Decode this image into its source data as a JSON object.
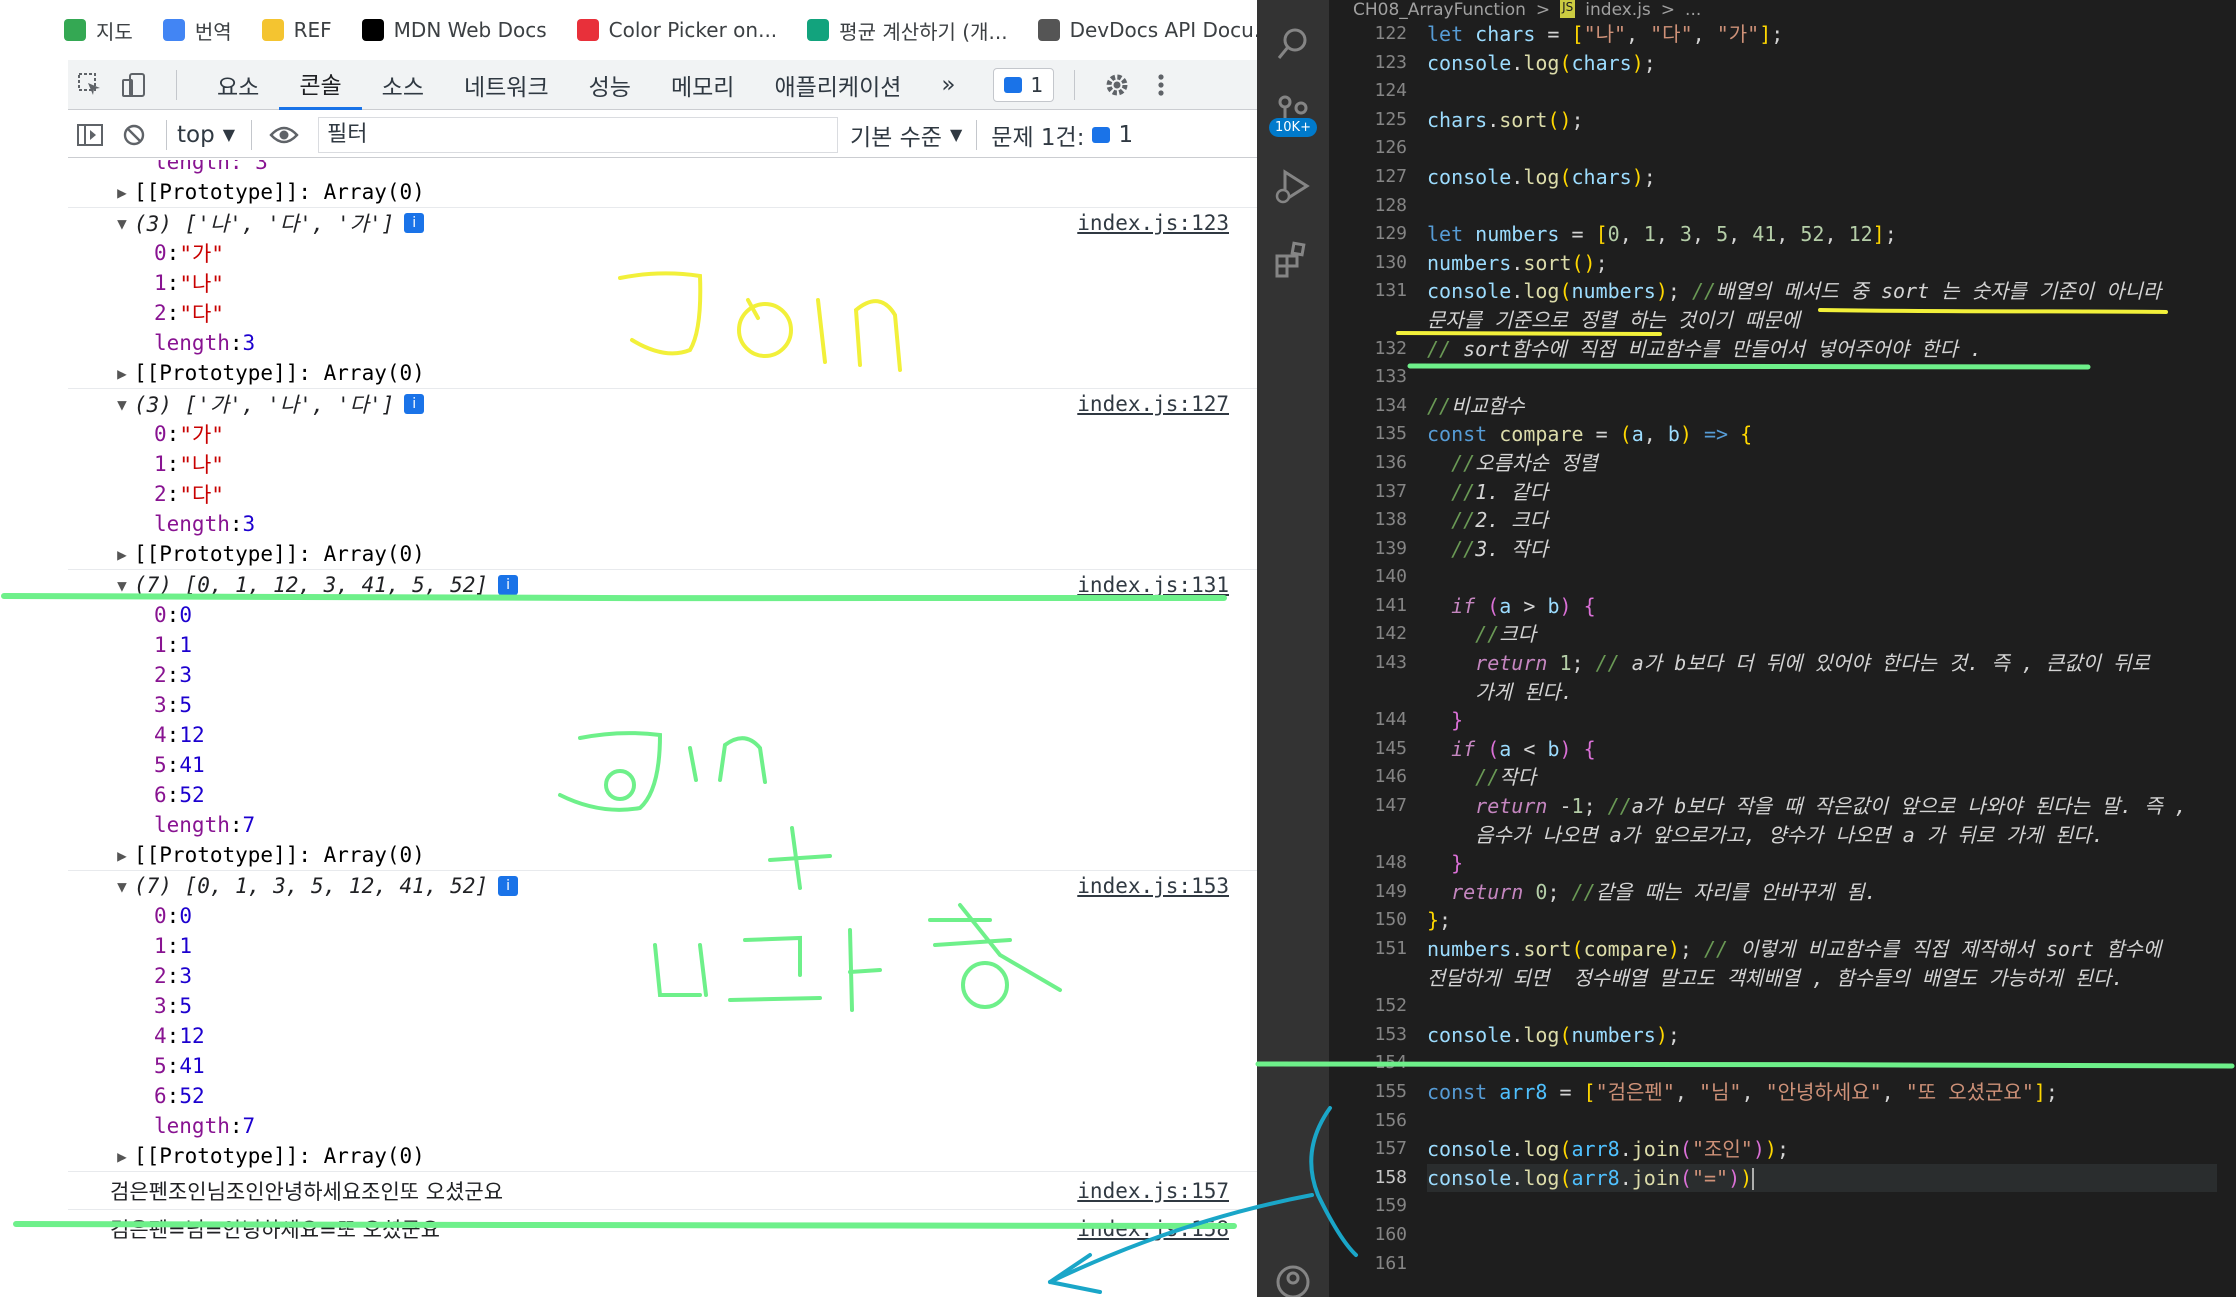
{
  "bookmarks": [
    {
      "label": "지도",
      "icon": "map-pin-icon",
      "color": "#34a853"
    },
    {
      "label": "번역",
      "icon": "translate-icon",
      "color": "#4285f4"
    },
    {
      "label": "REF",
      "icon": "folder-icon",
      "color": "#f4c430"
    },
    {
      "label": "MDN Web Docs",
      "icon": "mdn-icon",
      "color": "#000000"
    },
    {
      "label": "Color Picker on...",
      "icon": "color-picker-icon",
      "color": "#e8303a"
    },
    {
      "label": "평균 계산하기 (개...",
      "icon": "calculator-icon",
      "color": "#12a37d"
    },
    {
      "label": "DevDocs API Docu...",
      "icon": "devdocs-icon",
      "color": "#555555"
    }
  ],
  "devtools": {
    "tabs": [
      "요소",
      "콘솔",
      "소스",
      "네트워크",
      "성능",
      "메모리",
      "애플리케이션"
    ],
    "active_tab": "콘솔",
    "more_tabs": "»",
    "issues_count": "1",
    "context": "top",
    "filter_placeholder": "필터",
    "level": "기본 수준",
    "issues_label": "문제 1건:",
    "issues_label_count": "1"
  },
  "console": {
    "truncated_top": "length: 3",
    "prototype": "[[Prototype]]: Array(0)",
    "length_key": "length",
    "groups": [
      {
        "preview": "(3) ['나', '다', '가']",
        "source": "index.js:123",
        "items": [
          [
            "0",
            "\"가\""
          ],
          [
            "1",
            "\"나\""
          ],
          [
            "2",
            "\"다\""
          ]
        ],
        "length": "3"
      },
      {
        "preview": "(3) ['가', '나', '다']",
        "source": "index.js:127",
        "items": [
          [
            "0",
            "\"가\""
          ],
          [
            "1",
            "\"나\""
          ],
          [
            "2",
            "\"다\""
          ]
        ],
        "length": "3"
      },
      {
        "preview": "(7) [0, 1, 12, 3, 41, 5, 52]",
        "source": "index.js:131",
        "items": [
          [
            "0",
            "0"
          ],
          [
            "1",
            "1"
          ],
          [
            "2",
            "3"
          ],
          [
            "3",
            "5"
          ],
          [
            "4",
            "12"
          ],
          [
            "5",
            "41"
          ],
          [
            "6",
            "52"
          ]
        ],
        "length": "7"
      },
      {
        "preview": "(7) [0, 1, 3, 5, 12, 41, 52]",
        "source": "index.js:153",
        "items": [
          [
            "0",
            "0"
          ],
          [
            "1",
            "1"
          ],
          [
            "2",
            "3"
          ],
          [
            "3",
            "5"
          ],
          [
            "4",
            "12"
          ],
          [
            "5",
            "41"
          ],
          [
            "6",
            "52"
          ]
        ],
        "length": "7"
      }
    ],
    "plain_logs": [
      {
        "text": "검은펜조인님조인안녕하세요조인또 오셨군요",
        "source": "index.js:157"
      },
      {
        "text": "검은펜=님=안녕하세요=또 오셨군요",
        "source": "index.js:158"
      }
    ]
  },
  "vscode": {
    "breadcrumb": [
      "CH08_ArrayFunction",
      ">",
      "JS",
      "index.js",
      ">",
      "..."
    ],
    "badge": "10K+",
    "line_numbers": [
      "122",
      "123",
      "124",
      "125",
      "126",
      "127",
      "128",
      "129",
      "130",
      "131",
      "",
      "132",
      "133",
      "134",
      "135",
      "136",
      "137",
      "138",
      "139",
      "140",
      "141",
      "142",
      "143",
      "",
      "144",
      "145",
      "146",
      "147",
      "",
      "148",
      "149",
      "150",
      "151",
      "",
      "152",
      "153",
      "154",
      "155",
      "156",
      "157",
      "158",
      "159",
      "160",
      "161"
    ],
    "current_line": "158",
    "code_lines": [
      [
        [
          "kw",
          "let "
        ],
        [
          "vr",
          "chars"
        ],
        [
          "",
          ""
        ],
        [
          "",
          " = "
        ],
        [
          "br1",
          "["
        ],
        [
          "s",
          "\"나\""
        ],
        [
          "",
          ", "
        ],
        [
          "s",
          "\"다\""
        ],
        [
          "",
          ", "
        ],
        [
          "s",
          "\"가\""
        ],
        [
          "br1",
          "]"
        ],
        [
          "",
          ";"
        ]
      ],
      [
        [
          "vr",
          "console"
        ],
        [
          "",
          "."
        ],
        [
          "fn",
          "log"
        ],
        [
          "br1",
          "("
        ],
        [
          "vr",
          "chars"
        ],
        [
          "br1",
          ")"
        ],
        [
          "",
          ";"
        ]
      ],
      [],
      [
        [
          "vr",
          "chars"
        ],
        [
          "",
          "."
        ],
        [
          "fn",
          "sort"
        ],
        [
          "br1",
          "()"
        ],
        [
          "",
          ";"
        ]
      ],
      [],
      [
        [
          "vr",
          "console"
        ],
        [
          "",
          "."
        ],
        [
          "fn",
          "log"
        ],
        [
          "br1",
          "("
        ],
        [
          "vr",
          "chars"
        ],
        [
          "br1",
          ")"
        ],
        [
          "",
          ";"
        ]
      ],
      [],
      [
        [
          "kw",
          "let "
        ],
        [
          "vr",
          "numbers"
        ],
        [
          "",
          " = "
        ],
        [
          "br1",
          "["
        ],
        [
          "n",
          "0"
        ],
        [
          "",
          ", "
        ],
        [
          "n",
          "1"
        ],
        [
          "",
          ", "
        ],
        [
          "n",
          "3"
        ],
        [
          "",
          ", "
        ],
        [
          "n",
          "5"
        ],
        [
          "",
          ", "
        ],
        [
          "n",
          "41"
        ],
        [
          "",
          ", "
        ],
        [
          "n",
          "52"
        ],
        [
          "",
          ", "
        ],
        [
          "n",
          "12"
        ],
        [
          "br1",
          "]"
        ],
        [
          "",
          ";"
        ]
      ],
      [
        [
          "vr",
          "numbers"
        ],
        [
          "",
          "."
        ],
        [
          "fn",
          "sort"
        ],
        [
          "br1",
          "()"
        ],
        [
          "",
          ";"
        ]
      ],
      [
        [
          "vr",
          "console"
        ],
        [
          "",
          "."
        ],
        [
          "fn",
          "log"
        ],
        [
          "br1",
          "("
        ],
        [
          "vr",
          "numbers"
        ],
        [
          "br1",
          ")"
        ],
        [
          "",
          "; "
        ],
        [
          "cm",
          "//"
        ],
        [
          "cmw",
          "배열의 메서드 중 sort 는 숫자를 기준이 아니라"
        ]
      ],
      [
        [
          "cmw",
          "문자를 기준으로 정렬 하는 것이기 때문에"
        ]
      ],
      [
        [
          "cm",
          "// "
        ],
        [
          "cmw",
          "sort함수에 직접 비교함수를 만들어서 넣어주어야 한다 ."
        ]
      ],
      [],
      [
        [
          "cm",
          "//"
        ],
        [
          "cmw",
          "비교함수"
        ]
      ],
      [
        [
          "kw",
          "const "
        ],
        [
          "fn",
          "compare"
        ],
        [
          "",
          " = "
        ],
        [
          "br1",
          "("
        ],
        [
          "vr",
          "a"
        ],
        [
          "",
          ", "
        ],
        [
          "vr",
          "b"
        ],
        [
          "br1",
          ")"
        ],
        [
          "",
          " "
        ],
        [
          "kw",
          "=>"
        ],
        [
          "",
          " "
        ],
        [
          "br1",
          "{"
        ]
      ],
      [
        [
          "",
          "  "
        ],
        [
          "cm",
          "//"
        ],
        [
          "cmw",
          "오름차순 정렬"
        ]
      ],
      [
        [
          "",
          "  "
        ],
        [
          "cm",
          "//"
        ],
        [
          "cmw",
          "1. 같다"
        ]
      ],
      [
        [
          "",
          "  "
        ],
        [
          "cm",
          "//"
        ],
        [
          "cmw",
          "2. 크다"
        ]
      ],
      [
        [
          "",
          "  "
        ],
        [
          "cm",
          "//"
        ],
        [
          "cmw",
          "3. 작다"
        ]
      ],
      [],
      [
        [
          "",
          "  "
        ],
        [
          "ctl",
          "if"
        ],
        [
          "",
          " "
        ],
        [
          "br2",
          "("
        ],
        [
          "vr",
          "a"
        ],
        [
          "",
          " > "
        ],
        [
          "vr",
          "b"
        ],
        [
          "br2",
          ")"
        ],
        [
          "",
          " "
        ],
        [
          "br2",
          "{"
        ]
      ],
      [
        [
          "",
          "    "
        ],
        [
          "cm",
          "//"
        ],
        [
          "cmw",
          "크다"
        ]
      ],
      [
        [
          "",
          "    "
        ],
        [
          "ctl",
          "return "
        ],
        [
          "n",
          "1"
        ],
        [
          "",
          "; "
        ],
        [
          "cm",
          "// "
        ],
        [
          "cmw",
          "a가 b보다 더 뒤에 있어야 한다는 것. 즉 , 큰값이 뒤로"
        ]
      ],
      [
        [
          "",
          "    "
        ],
        [
          "cmw",
          "가게 된다."
        ]
      ],
      [
        [
          "",
          "  "
        ],
        [
          "br2",
          "}"
        ]
      ],
      [
        [
          "",
          "  "
        ],
        [
          "ctl",
          "if"
        ],
        [
          "",
          " "
        ],
        [
          "br2",
          "("
        ],
        [
          "vr",
          "a"
        ],
        [
          "",
          " < "
        ],
        [
          "vr",
          "b"
        ],
        [
          "br2",
          ")"
        ],
        [
          "",
          " "
        ],
        [
          "br2",
          "{"
        ]
      ],
      [
        [
          "",
          "    "
        ],
        [
          "cm",
          "//"
        ],
        [
          "cmw",
          "작다"
        ]
      ],
      [
        [
          "",
          "    "
        ],
        [
          "ctl",
          "return "
        ],
        [
          "",
          "-"
        ],
        [
          "n",
          "1"
        ],
        [
          "",
          "; "
        ],
        [
          "cm",
          "//"
        ],
        [
          "cmw",
          "a가 b보다 작을 때 작은값이 앞으로 나와야 된다는 말. 즉 ,"
        ]
      ],
      [
        [
          "",
          "    "
        ],
        [
          "cmw",
          "음수가 나오면 a가 앞으로가고, 양수가 나오면 a 가 뒤로 가게 된다."
        ]
      ],
      [
        [
          "",
          "  "
        ],
        [
          "br2",
          "}"
        ]
      ],
      [
        [
          "",
          "  "
        ],
        [
          "ctl",
          "return "
        ],
        [
          "n",
          "0"
        ],
        [
          "",
          "; "
        ],
        [
          "cm",
          "//"
        ],
        [
          "cmw",
          "같을 때는 자리를 안바꾸게 됨."
        ]
      ],
      [
        [
          "br1",
          "}"
        ],
        [
          "",
          ";"
        ]
      ],
      [
        [
          "vr",
          "numbers"
        ],
        [
          "",
          "."
        ],
        [
          "fn",
          "sort"
        ],
        [
          "br1",
          "("
        ],
        [
          "fn",
          "compare"
        ],
        [
          "br1",
          ")"
        ],
        [
          "",
          "; "
        ],
        [
          "cm",
          "// "
        ],
        [
          "cmw",
          "이렇게 비교함수를 직접 제작해서 sort 함수에"
        ]
      ],
      [
        [
          "cmw",
          "전달하게 되면  정수배열 말고도 객체배열 , 함수들의 배열도 가능하게 된다."
        ]
      ],
      [],
      [
        [
          "vr",
          "console"
        ],
        [
          "",
          "."
        ],
        [
          "fn",
          "log"
        ],
        [
          "br1",
          "("
        ],
        [
          "vr",
          "numbers"
        ],
        [
          "br1",
          ")"
        ],
        [
          "",
          ";"
        ]
      ],
      [],
      [
        [
          "kw",
          "const "
        ],
        [
          "cn",
          "arr8"
        ],
        [
          "",
          " = "
        ],
        [
          "br1",
          "["
        ],
        [
          "s",
          "\"검은펜\""
        ],
        [
          "",
          ", "
        ],
        [
          "s",
          "\"님\""
        ],
        [
          "",
          ", "
        ],
        [
          "s",
          "\"안녕하세요\""
        ],
        [
          "",
          ", "
        ],
        [
          "s",
          "\"또 오셨군요\""
        ],
        [
          "br1",
          "]"
        ],
        [
          "",
          ";"
        ]
      ],
      [],
      [
        [
          "vr",
          "console"
        ],
        [
          "",
          "."
        ],
        [
          "fn",
          "log"
        ],
        [
          "br1",
          "("
        ],
        [
          "cn",
          "arr8"
        ],
        [
          "",
          "."
        ],
        [
          "fn",
          "join"
        ],
        [
          "br2",
          "("
        ],
        [
          "s",
          "\"조인\""
        ],
        [
          "br2",
          ")"
        ],
        [
          "br1",
          ")"
        ],
        [
          "",
          ";"
        ]
      ],
      [
        [
          "vr",
          "console"
        ],
        [
          "",
          "."
        ],
        [
          "fn",
          "log"
        ],
        [
          "br1",
          "("
        ],
        [
          "cn",
          "arr8"
        ],
        [
          "",
          "."
        ],
        [
          "fn",
          "join"
        ],
        [
          "br2",
          "("
        ],
        [
          "s",
          "\"=\""
        ],
        [
          "br2",
          ")"
        ],
        [
          "br1",
          ")"
        ]
      ],
      [],
      [],
      []
    ]
  },
  "colors": {
    "highlight_green": "#6ef08a",
    "highlight_yellow": "#f2f03a",
    "arrow_blue": "#1aa6c8"
  }
}
